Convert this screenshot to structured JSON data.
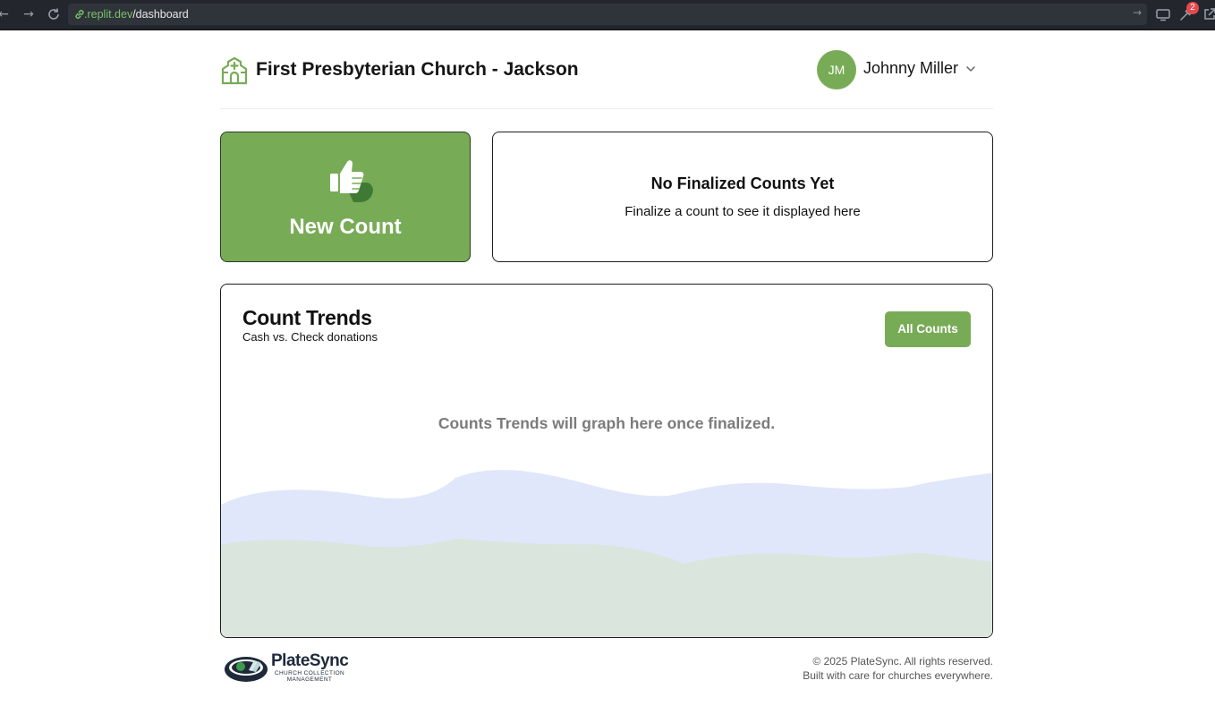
{
  "browser": {
    "url_domain": ".replit.dev",
    "url_path": "/dashboard",
    "notification_count": "2",
    "icons": [
      "back-icon",
      "forward-icon",
      "reload-icon",
      "link-icon",
      "go-icon",
      "screen-icon",
      "wrench-icon",
      "external-link-icon"
    ]
  },
  "header": {
    "church_name": "First Presbyterian Church - Jackson",
    "user_initials": "JM",
    "user_name": "Johnny Miller"
  },
  "new_count": {
    "label": "New Count",
    "icon": "thumbs-up-icon"
  },
  "finalized": {
    "title": "No Finalized Counts Yet",
    "subtitle": "Finalize a count to see it displayed here"
  },
  "trends": {
    "title": "Count Trends",
    "subtitle": "Cash vs. Check donations",
    "button_label": "All Counts",
    "empty_message": "Counts Trends will graph here once finalized."
  },
  "footer": {
    "brand": "PlateSync",
    "tagline_line1": "CHURCH COLLECTION",
    "tagline_line2": "MANAGEMENT",
    "copyright": "© 2025 PlateSync. All rights reserved.",
    "built_with": "Built with care for churches everywhere."
  },
  "colors": {
    "brand_green": "#78ab56",
    "wave_blue": "#e0e7fa",
    "wave_green": "#dae6dd",
    "browser_bar": "#23262c"
  }
}
